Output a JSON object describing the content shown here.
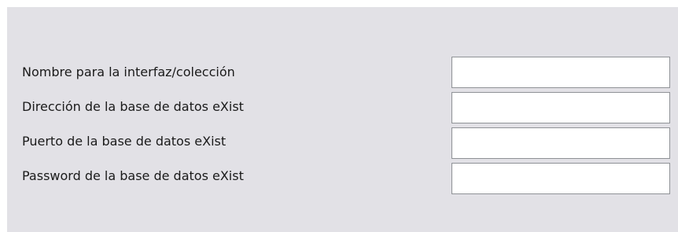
{
  "form": {
    "fields": [
      {
        "label": "Nombre para la interfaz/colección",
        "value": ""
      },
      {
        "label": "Dirección de la base de datos eXist",
        "value": ""
      },
      {
        "label": "Puerto de la base de datos eXist",
        "value": ""
      },
      {
        "label": "Password de la base de datos eXist",
        "value": ""
      }
    ]
  }
}
